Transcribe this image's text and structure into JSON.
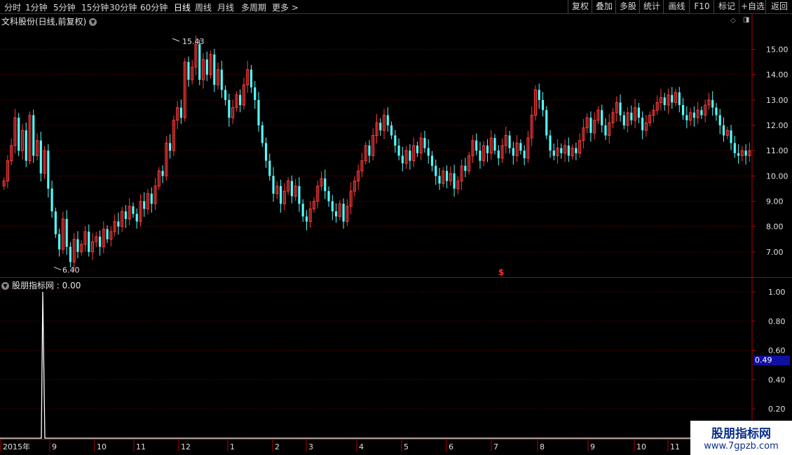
{
  "toolbar": {
    "periods": [
      "分时",
      "1分钟",
      "5分钟",
      "15分钟",
      "30分钟",
      "60分钟",
      "日线",
      "周线",
      "月线",
      "多周期",
      "更多 >"
    ],
    "active_period": "日线",
    "right_buttons": [
      "复权",
      "叠加",
      "多股",
      "统计",
      "画线",
      "F10",
      "标记",
      "+自选",
      "返回"
    ]
  },
  "main_chart": {
    "title": "文科股份(日线,前复权)",
    "high_label": "15.43",
    "low_label": "6.40",
    "s_marker": "$",
    "y_ticks": [
      "15.00",
      "14.00",
      "13.00",
      "12.00",
      "11.00",
      "10.00",
      "9.00",
      "8.00",
      "7.00"
    ]
  },
  "indicator": {
    "title": "股朋指标网 : 0.00",
    "y_ticks": [
      "1.00",
      "0.80",
      "0.60",
      "0.40",
      "0.20"
    ],
    "current_value": "0.49"
  },
  "x_axis": {
    "labels": [
      "2015年",
      "9",
      "10",
      "11",
      "12",
      "1",
      "2",
      "3",
      "4",
      "5",
      "6",
      "7",
      "8",
      "9",
      "10",
      "11"
    ]
  },
  "watermark": {
    "title": "股朋指标网",
    "url": "www.7gpzb.com"
  },
  "colors": {
    "up": "#ff3b3b",
    "down": "#54ffff",
    "grid": "#8b0000",
    "frame": "#b00000",
    "indicator_line": "#ffffff",
    "badge": "#1010a0"
  },
  "chart_data": {
    "type": "candlestick",
    "period": "daily",
    "adjustment": "forward-adjusted",
    "price_range": [
      6.4,
      15.43
    ],
    "closes": [
      9.8,
      10.6,
      11.2,
      12.3,
      11.0,
      11.8,
      10.6,
      12.4,
      10.8,
      11.4,
      10.1,
      11.0,
      9.5,
      8.6,
      7.7,
      7.1,
      8.3,
      7.2,
      6.6,
      7.5,
      7.0,
      7.3,
      7.8,
      7.0,
      7.4,
      7.6,
      7.2,
      7.9,
      7.5,
      7.8,
      8.2,
      8.0,
      8.6,
      8.3,
      8.8,
      8.5,
      8.2,
      9.0,
      8.7,
      9.3,
      8.9,
      9.6,
      10.2,
      10.0,
      11.3,
      11.0,
      12.2,
      12.7,
      12.3,
      14.5,
      13.8,
      14.3,
      15.2,
      13.8,
      14.6,
      14.0,
      14.8,
      13.6,
      14.2,
      13.4,
      13.0,
      12.3,
      12.7,
      13.2,
      12.8,
      13.6,
      14.2,
      13.5,
      13.0,
      12.0,
      11.3,
      10.6,
      10.0,
      9.3,
      9.6,
      8.9,
      9.4,
      9.8,
      9.2,
      9.6,
      8.9,
      8.4,
      8.2,
      8.7,
      9.0,
      9.6,
      9.9,
      9.4,
      9.0,
      8.6,
      8.4,
      8.9,
      8.2,
      8.8,
      9.4,
      9.8,
      10.2,
      10.6,
      11.2,
      10.8,
      11.6,
      12.1,
      11.8,
      12.4,
      12.0,
      11.6,
      11.2,
      10.8,
      10.5,
      11.0,
      10.6,
      11.2,
      10.9,
      11.5,
      11.1,
      10.8,
      10.4,
      10.0,
      9.7,
      10.2,
      9.8,
      10.1,
      9.5,
      9.8,
      10.4,
      10.2,
      10.8,
      11.4,
      11.0,
      10.6,
      11.2,
      10.9,
      11.5,
      11.0,
      10.7,
      11.2,
      11.6,
      11.1,
      10.8,
      11.3,
      11.0,
      10.7,
      11.5,
      12.4,
      13.4,
      13.0,
      12.6,
      11.6,
      11.0,
      10.8,
      11.1,
      10.9,
      11.2,
      10.8,
      11.1,
      10.9,
      11.4,
      11.9,
      12.3,
      11.7,
      12.2,
      12.6,
      12.0,
      11.6,
      12.1,
      12.5,
      12.9,
      12.4,
      12.0,
      12.5,
      12.2,
      12.7,
      12.3,
      11.8,
      12.1,
      12.4,
      12.6,
      12.9,
      13.1,
      12.8,
      13.2,
      12.9,
      13.3,
      12.8,
      12.4,
      12.2,
      12.5,
      12.3,
      12.6,
      12.4,
      12.8,
      13.0,
      12.7,
      12.4,
      12.0,
      11.6,
      11.8,
      11.3,
      10.9,
      10.8,
      11.0,
      10.8,
      11.0
    ],
    "indicator_values_note": "single spike to 1.00 near early September 2015, zero elsewhere",
    "indicator_spike": {
      "x": "2015-09",
      "value": 1.0
    },
    "indicator_ylim": [
      0,
      1.0
    ]
  }
}
